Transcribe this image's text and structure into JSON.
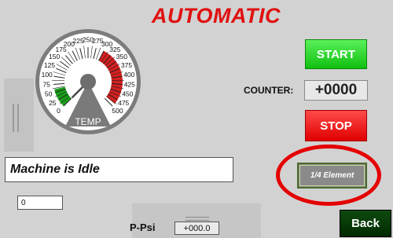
{
  "header": {
    "mode_title": "AUTOMATIC"
  },
  "gauge": {
    "label": "TEMP",
    "tick_labels": [
      "0",
      "25",
      "50",
      "75",
      "100",
      "125",
      "150",
      "175",
      "200",
      "225",
      "250",
      "275",
      "300",
      "325",
      "350",
      "375",
      "400",
      "425",
      "450",
      "475",
      "500"
    ],
    "min": 0,
    "max": 500,
    "value": 0,
    "zones": [
      {
        "from": 0,
        "to": 60,
        "color": "#1aa01a"
      },
      {
        "from": 60,
        "to": 300,
        "color": "#ffffff"
      },
      {
        "from": 300,
        "to": 490,
        "color": "#d42020"
      }
    ]
  },
  "controls": {
    "start_label": "START",
    "stop_label": "STOP",
    "counter_label": "COUNTER:",
    "counter_value": "+0000",
    "element_label": "1/4 Element",
    "back_label": "Back"
  },
  "status": {
    "message": "Machine is Idle"
  },
  "small_field": {
    "value": "0"
  },
  "pressure": {
    "label": "P-Psi",
    "value": "+000.0"
  },
  "colors": {
    "title_red": "#e01010",
    "start_green": "#22d022",
    "stop_red": "#f01010",
    "back_dark_green": "#003300",
    "highlight_ring": "#e50000"
  }
}
